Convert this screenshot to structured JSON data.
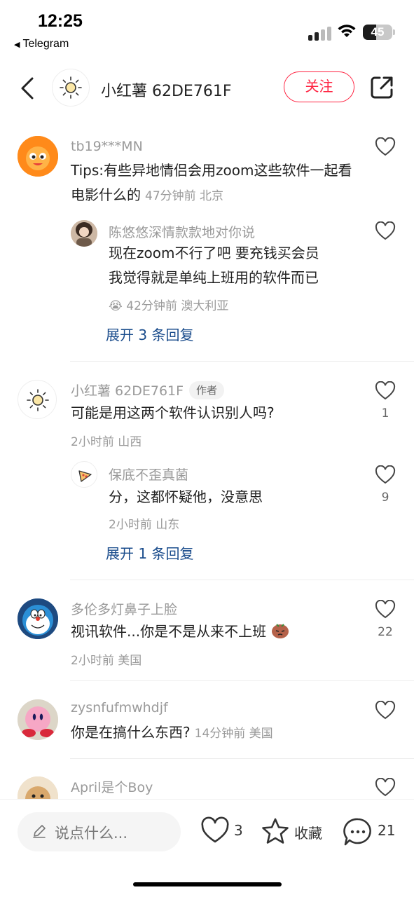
{
  "status_bar": {
    "time": "12:25",
    "back_app": "Telegram",
    "battery": "45",
    "battery_level": 0.45
  },
  "header": {
    "name": "小红薯 62DE761F",
    "follow_label": "关注"
  },
  "comments": [
    {
      "user": "tb19***MN",
      "text": "Tips:有些异地情侣会用zoom这些软件一起看电影什么的",
      "meta": "47分钟前 北京",
      "replies": [
        {
          "user": "陈悠悠深情款款地对你说",
          "text_line1": "现在zoom不行了吧 要充钱买会员",
          "text_line2": "我觉得就是单纯上班用的软件而已",
          "emoji": "😭",
          "meta": "42分钟前 澳大利亚"
        }
      ],
      "expand_label": "展开 3 条回复"
    },
    {
      "user": "小红薯 62DE761F",
      "author_tag": "作者",
      "text": "可能是用这两个软件认识别人吗?",
      "meta": "2小时前 山西",
      "likes": "1",
      "replies": [
        {
          "user": "保底不歪真菌",
          "text": "分，这都怀疑他，没意思",
          "meta": "2小时前 山东",
          "likes": "9"
        }
      ],
      "expand_label": "展开 1 条回复"
    },
    {
      "user": "多伦多灯鼻子上脸",
      "text": "视讯软件...你是不是从来不上班",
      "meta": "2小时前 美国",
      "likes": "22"
    },
    {
      "user": "zysnfufmwhdjf",
      "text": "你是在搞什么东西?",
      "meta": "14分钟前 美国"
    },
    {
      "user": "April是个Boy"
    }
  ],
  "bottom_bar": {
    "input_placeholder": "说点什么...",
    "like_count": "3",
    "collect_label": "收藏",
    "comment_count": "21"
  },
  "colors": {
    "accent": "#ff2442",
    "link": "#1a4c8c",
    "muted": "#9a9a9a"
  }
}
